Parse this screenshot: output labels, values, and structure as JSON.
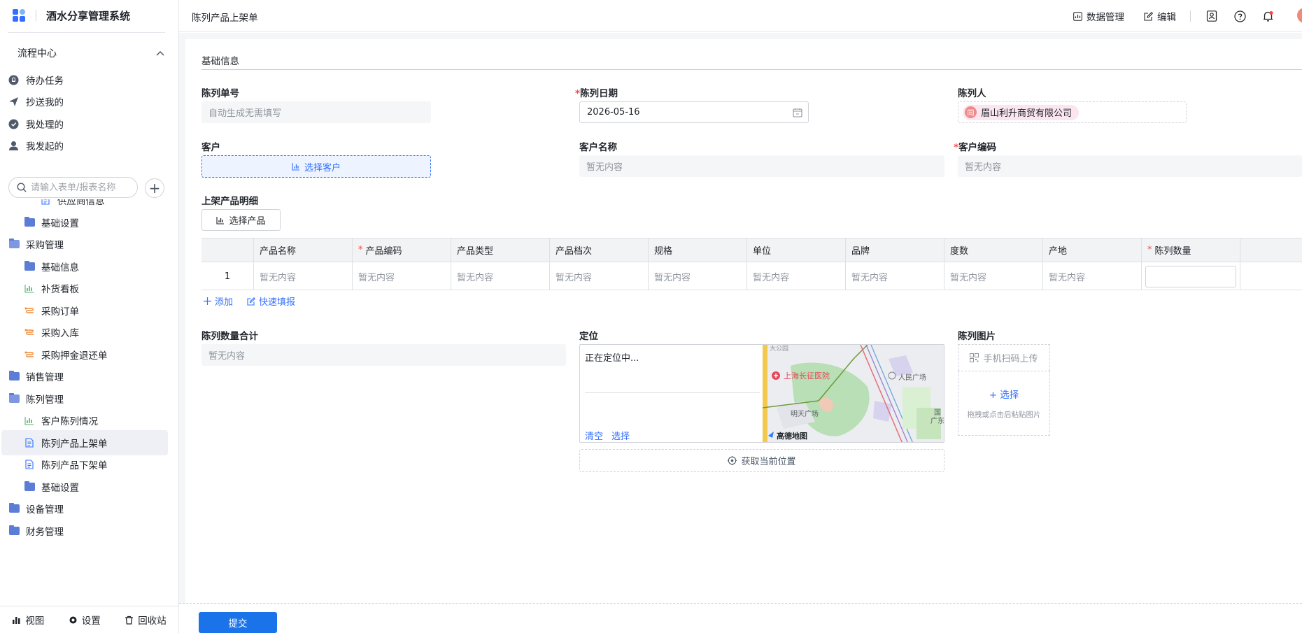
{
  "app": {
    "title": "酒水分享管理系统",
    "page_title": "陈列产品上架单"
  },
  "colors": {
    "primary": "#3370ff",
    "required": "#f54a45",
    "submit": "#1a73e8"
  },
  "sidebar": {
    "flow_center": "流程中心",
    "flow_items": [
      {
        "label": "待办任务",
        "icon": "bell-icon"
      },
      {
        "label": "抄送我的",
        "icon": "send-icon"
      },
      {
        "label": "我处理的",
        "icon": "check-circle-icon"
      },
      {
        "label": "我发起的",
        "icon": "user-icon"
      }
    ],
    "search_placeholder": "请输入表单/报表名称",
    "tree": [
      {
        "label": "供应商信息",
        "level": 2,
        "icon": "doc-icon"
      },
      {
        "label": "基础设置",
        "level": 1,
        "icon": "folder-icon"
      },
      {
        "label": "采购管理",
        "level": 0,
        "icon": "folder-open-icon"
      },
      {
        "label": "基础信息",
        "level": 1,
        "icon": "folder-icon"
      },
      {
        "label": "补货看板",
        "level": 1,
        "icon": "chart-icon"
      },
      {
        "label": "采购订单",
        "level": 1,
        "icon": "flow-icon"
      },
      {
        "label": "采购入库",
        "level": 1,
        "icon": "flow-icon"
      },
      {
        "label": "采购押金退还单",
        "level": 1,
        "icon": "flow-icon"
      },
      {
        "label": "销售管理",
        "level": 0,
        "icon": "folder-icon"
      },
      {
        "label": "陈列管理",
        "level": 0,
        "icon": "folder-open-icon"
      },
      {
        "label": "客户陈列情况",
        "level": 1,
        "icon": "chart-icon"
      },
      {
        "label": "陈列产品上架单",
        "level": 1,
        "icon": "doc-icon",
        "active": true
      },
      {
        "label": "陈列产品下架单",
        "level": 1,
        "icon": "doc-icon"
      },
      {
        "label": "基础设置",
        "level": 1,
        "icon": "folder-icon"
      },
      {
        "label": "设备管理",
        "level": 0,
        "icon": "folder-icon"
      },
      {
        "label": "财务管理",
        "level": 0,
        "icon": "folder-icon"
      }
    ],
    "footer": {
      "view": "视图",
      "settings": "设置",
      "recycle": "回收站"
    }
  },
  "topbar": {
    "data_manage": "数据管理",
    "edit": "编辑"
  },
  "form": {
    "section_title": "基础信息",
    "order_no": {
      "label": "陈列单号",
      "placeholder": "自动生成无需填写"
    },
    "display_date": {
      "label": "陈列日期",
      "value": "2026-05-16"
    },
    "display_person": {
      "label": "陈列人",
      "tag_avatar": "同",
      "tag_label": "眉山利升商贸有限公司"
    },
    "customer": {
      "label": "客户",
      "button": "选择客户"
    },
    "customer_name": {
      "label": "客户名称",
      "value": "暂无内容"
    },
    "customer_code": {
      "label": "客户编码",
      "value": "暂无内容"
    },
    "detail": {
      "label": "上架产品明细",
      "select_button": "选择产品",
      "columns": [
        "产品名称",
        "产品编码",
        "产品类型",
        "产品档次",
        "规格",
        "单位",
        "品牌",
        "度数",
        "产地",
        "陈列数量"
      ],
      "row_index": "1",
      "empty": "暂无内容",
      "add": "添加",
      "quick_fill": "快速填报"
    },
    "total_qty": {
      "label": "陈列数量合计",
      "value": "暂无内容"
    },
    "location": {
      "label": "定位",
      "status": "正在定位中...",
      "clear": "清空",
      "choose": "选择",
      "get_current": "获取当前位置",
      "map_labels": {
        "hospital": "上海长征医院",
        "square": "人民广场",
        "mingtian": "明天广场",
        "guo": "国",
        "guang": "广东",
        "brand": "高德地图",
        "top": "大公园"
      }
    },
    "images": {
      "label": "陈列图片",
      "scan": "手机扫码上传",
      "choose": "选择",
      "hint": "拖拽或点击后粘贴图片"
    },
    "submit": "提交"
  }
}
